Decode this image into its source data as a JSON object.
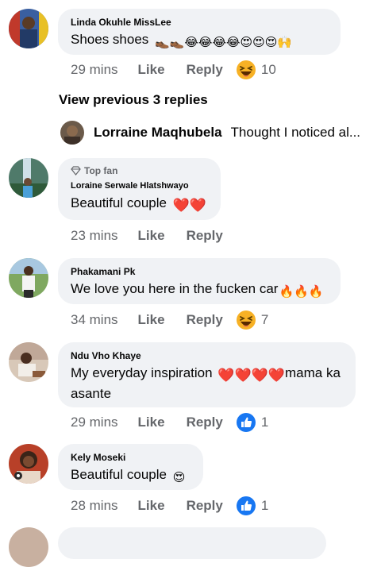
{
  "comments": [
    {
      "author": "Linda Okuhle MissLee",
      "text": "Shoes shoes",
      "emoji": "👞👞😂😂😂😂😍😍😍🙌",
      "time": "29 mins",
      "like": "Like",
      "reply": "Reply",
      "reaction": {
        "icon": "haha-icon",
        "count": "10"
      }
    },
    {
      "author": "Loraine Serwale Hlatshwayo",
      "badge": "Top fan",
      "text": "Beautiful couple",
      "emoji": "❤️❤️",
      "time": "23 mins",
      "like": "Like",
      "reply": "Reply"
    },
    {
      "author": "Phakamani Pk",
      "text": "We love you here in the fucken car",
      "emoji": "🔥🔥🔥",
      "time": "34 mins",
      "like": "Like",
      "reply": "Reply",
      "reaction": {
        "icon": "haha-icon",
        "count": "7"
      }
    },
    {
      "author": "Ndu Vho Khaye",
      "text_line1": "My everyday inspiration",
      "emoji": "❤️❤️❤️❤️",
      "text_line1_tail": "mama ka",
      "text_line2": "asante",
      "time": "29 mins",
      "like": "Like",
      "reply": "Reply",
      "reaction": {
        "icon": "like-icon",
        "count": "1"
      }
    },
    {
      "author": "Kely Moseki",
      "text": "Beautiful couple",
      "emoji": "😍",
      "time": "28 mins",
      "like": "Like",
      "reply": "Reply",
      "reaction": {
        "icon": "like-icon",
        "count": "1"
      }
    }
  ],
  "view_previous": "View previous 3 replies",
  "reply_preview": {
    "author": "Lorraine Maqhubela",
    "text": "Thought I noticed al..."
  },
  "colors": {
    "bubble": "#f0f2f5",
    "meta_text": "#65676b",
    "like_blue": "#1877f2",
    "haha_yellow": "#f7b125"
  }
}
